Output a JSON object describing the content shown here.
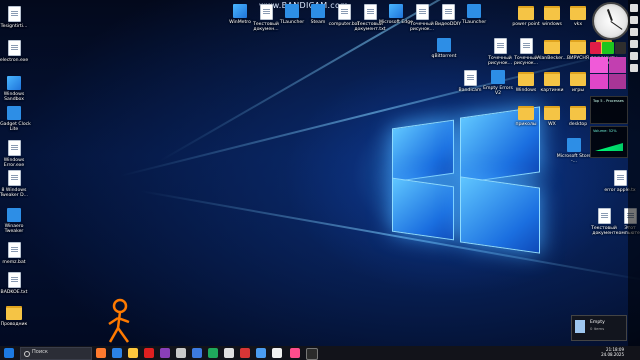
{
  "watermark": {
    "brand": "www.BANDICAM",
    "domain": ".com"
  },
  "left_icons": [
    {
      "label": "Tesigntirti...",
      "kind": "doc"
    },
    {
      "label": "electron.exe",
      "kind": "doc"
    },
    {
      "label": "Windows Sandbox",
      "kind": "win"
    },
    {
      "label": "8Gadget Clock Lite",
      "kind": "blue"
    },
    {
      "label": "Windows Error.exe",
      "kind": "doc"
    },
    {
      "label": "8 Windows Tweaker D...",
      "kind": "doc"
    },
    {
      "label": "Winaero Tweaker",
      "kind": "blue"
    },
    {
      "label": "memz.bat",
      "kind": "doc"
    },
    {
      "label": "BADKOE.txt",
      "kind": "doc"
    },
    {
      "label": "Проводник",
      "kind": "folder"
    }
  ],
  "top_icons": [
    {
      "label": "WinMetro",
      "kind": "win"
    },
    {
      "label": "Текстовый докумен...",
      "kind": "doc"
    },
    {
      "label": "TLauncher",
      "kind": "blue"
    },
    {
      "label": "Steam",
      "kind": "blue"
    },
    {
      "label": "computer.bat",
      "kind": "doc"
    },
    {
      "label": "Текстовый документ.txt",
      "kind": "doc"
    },
    {
      "label": "Microsoft Edge",
      "kind": "win"
    },
    {
      "label": "Точечный рисунок...",
      "kind": "doc"
    },
    {
      "label": "ВидеоDDIY",
      "kind": "doc"
    },
    {
      "label": "TLauncher",
      "kind": "blue"
    },
    {
      "label": "power point",
      "kind": "folder"
    },
    {
      "label": "windows",
      "kind": "folder"
    },
    {
      "label": "vkx",
      "kind": "folder"
    }
  ],
  "right_icons": [
    {
      "label": "qBittorrent",
      "kind": "blue"
    },
    {
      "label": "Точечный рисунок...",
      "kind": "doc"
    },
    {
      "label": "Точечный рисунок...",
      "kind": "doc"
    },
    {
      "label": "AlanBecker...",
      "kind": "folder"
    },
    {
      "label": "ВИРУСНЯ",
      "kind": "folder"
    },
    {
      "label": "документы котики",
      "kind": "folder"
    },
    {
      "label": "Bandicam",
      "kind": "doc"
    },
    {
      "label": "Empty Errors V2",
      "kind": "blue"
    },
    {
      "label": "Windows",
      "kind": "folder"
    },
    {
      "label": "картинки",
      "kind": "folder"
    },
    {
      "label": "игры",
      "kind": "folder"
    },
    {
      "label": "приколы",
      "kind": "folder"
    },
    {
      "label": "WX",
      "kind": "folder"
    },
    {
      "label": "desktop",
      "kind": "folder"
    },
    {
      "label": "Microsoft Store -...",
      "kind": "blue"
    },
    {
      "label": "Текстовый документ",
      "kind": "doc"
    },
    {
      "label": "Этот компьюте...",
      "kind": "doc"
    },
    {
      "label": "error apple.tx",
      "kind": "doc"
    }
  ],
  "widgets": {
    "top5_title": "Top 5 - Processes",
    "volume_label": "Volume: 52%"
  },
  "notification": {
    "title": "Empty",
    "subtitle": "0 items"
  },
  "taskbar": {
    "search_placeholder": "Поиск",
    "time": "21:18:09",
    "date": "24.08.2025"
  },
  "colors": {
    "accent": "#1b6fe0",
    "taskbar": "#12131a",
    "folder": "#f5c445"
  }
}
